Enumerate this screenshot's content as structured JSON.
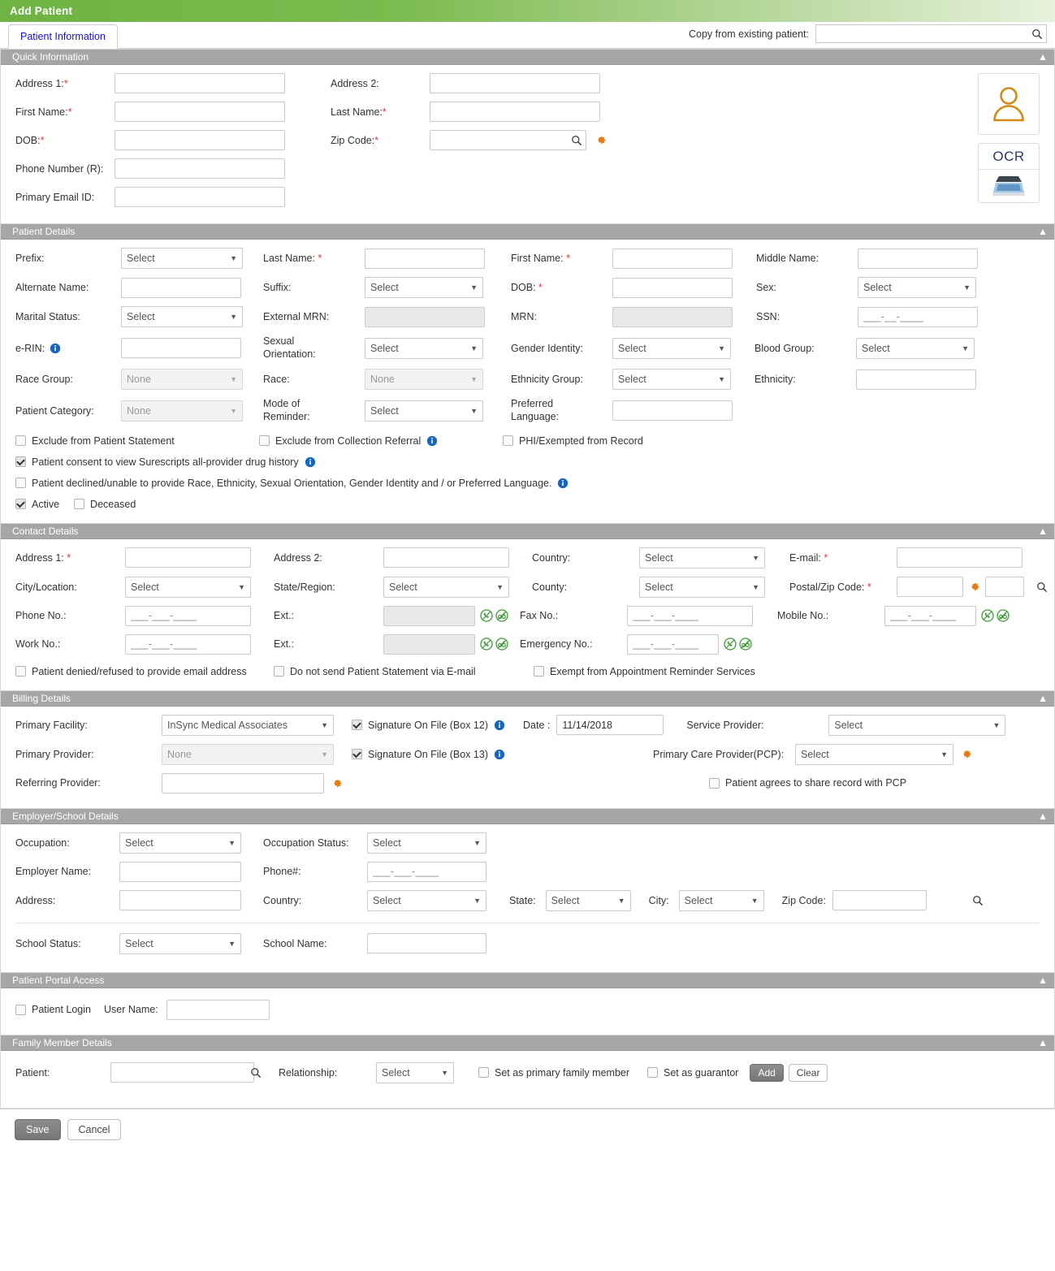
{
  "window": {
    "title": "Add Patient"
  },
  "tabs": [
    {
      "label": "Patient Information"
    }
  ],
  "copy_from": {
    "label": "Copy from existing patient:",
    "value": "",
    "placeholder": ""
  },
  "icons": {
    "search": "search-icon",
    "gear": "gear-icon",
    "info": "info-icon",
    "collapse": "chevron-up-icon",
    "avatar": "patient-avatar-icon",
    "scanner": "scanner-icon",
    "phone_ok": "phone-call-icon",
    "phone_no": "no-call-icon"
  },
  "quick_information": {
    "title": "Quick Information",
    "fields": {
      "address1": {
        "label": "Address 1:",
        "required": true,
        "value": ""
      },
      "address2": {
        "label": "Address 2:",
        "required": false,
        "value": ""
      },
      "first_name": {
        "label": "First Name:",
        "required": true,
        "value": ""
      },
      "last_name": {
        "label": "Last Name:",
        "required": true,
        "value": ""
      },
      "dob": {
        "label": "DOB:",
        "required": true,
        "value": ""
      },
      "zip_code": {
        "label": "Zip Code:",
        "required": true,
        "value": ""
      },
      "phone_r": {
        "label": "Phone Number (R):",
        "required": false,
        "value": ""
      },
      "primary_email": {
        "label": "Primary Email ID:",
        "required": false,
        "value": ""
      }
    },
    "ocr_label": "OCR"
  },
  "patient_details": {
    "title": "Patient Details",
    "fields": {
      "prefix": {
        "label": "Prefix:",
        "value": "Select"
      },
      "last_name": {
        "label": "Last Name:",
        "required": true,
        "value": ""
      },
      "first_name": {
        "label": "First Name:",
        "required": true,
        "value": ""
      },
      "middle_name": {
        "label": "Middle Name:",
        "value": ""
      },
      "alternate_name": {
        "label": "Alternate Name:",
        "value": ""
      },
      "suffix": {
        "label": "Suffix:",
        "value": "Select"
      },
      "dob": {
        "label": "DOB:",
        "required": true,
        "value": ""
      },
      "sex": {
        "label": "Sex:",
        "value": "Select"
      },
      "marital_status": {
        "label": "Marital Status:",
        "value": "Select"
      },
      "external_mrn": {
        "label": "External MRN:",
        "value": ""
      },
      "mrn": {
        "label": "MRN:",
        "value": ""
      },
      "ssn": {
        "label": "SSN:",
        "value": "___-__-____"
      },
      "erin": {
        "label": "e-RIN:",
        "value": ""
      },
      "sexual_orientation": {
        "label": "Sexual Orientation:",
        "value": "Select"
      },
      "gender_identity": {
        "label": "Gender Identity:",
        "value": "Select"
      },
      "blood_group": {
        "label": "Blood Group:",
        "value": "Select"
      },
      "race_group": {
        "label": "Race Group:",
        "value": "None"
      },
      "race": {
        "label": "Race:",
        "value": "None"
      },
      "ethnicity_group": {
        "label": "Ethnicity Group:",
        "value": "Select"
      },
      "ethnicity": {
        "label": "Ethnicity:",
        "value": ""
      },
      "patient_category": {
        "label": "Patient Category:",
        "value": "None"
      },
      "mode_of_reminder": {
        "label": "Mode of Reminder:",
        "value": "Select"
      },
      "preferred_language": {
        "label": "Preferred Language:",
        "value": ""
      }
    },
    "checkboxes": {
      "exclude_statement": {
        "label": "Exclude from Patient Statement",
        "checked": false
      },
      "exclude_collection": {
        "label": "Exclude from Collection Referral",
        "checked": false
      },
      "phi_exempt": {
        "label": "PHI/Exempted from Record",
        "checked": false
      },
      "surescripts_consent": {
        "label": "Patient consent to view Surescripts all-provider drug history",
        "checked": true
      },
      "declined_demographics": {
        "label": "Patient declined/unable to provide Race, Ethnicity, Sexual Orientation, Gender Identity and / or Preferred Language.",
        "checked": false
      },
      "active": {
        "label": "Active",
        "checked": true
      },
      "deceased": {
        "label": "Deceased",
        "checked": false
      }
    }
  },
  "contact_details": {
    "title": "Contact Details",
    "fields": {
      "address1": {
        "label": "Address 1:",
        "required": true,
        "value": ""
      },
      "address2": {
        "label": "Address 2:",
        "value": ""
      },
      "country": {
        "label": "Country:",
        "value": "Select"
      },
      "email": {
        "label": "E-mail:",
        "required": true,
        "value": ""
      },
      "city_location": {
        "label": "City/Location:",
        "value": "Select"
      },
      "state_region": {
        "label": "State/Region:",
        "value": "Select"
      },
      "county": {
        "label": "County:",
        "value": "Select"
      },
      "postal_zip": {
        "label": "Postal/Zip Code:",
        "required": true,
        "value": "",
        "ext_value": ""
      },
      "phone_no": {
        "label": "Phone No.:",
        "value": "___-___-____"
      },
      "phone_ext": {
        "label": "Ext.:",
        "value": ""
      },
      "fax_no": {
        "label": "Fax No.:",
        "value": "___-___-____"
      },
      "mobile_no": {
        "label": "Mobile No.:",
        "value": "___-___-____"
      },
      "work_no": {
        "label": "Work No.:",
        "value": "___-___-____"
      },
      "work_ext": {
        "label": "Ext.:",
        "value": ""
      },
      "emergency_no": {
        "label": "Emergency No.:",
        "value": "___-___-____"
      }
    },
    "checkboxes": {
      "denied_email": {
        "label": "Patient denied/refused to provide email address",
        "checked": false
      },
      "no_statement_email": {
        "label": "Do not send Patient Statement via E-mail",
        "checked": false
      },
      "exempt_reminders": {
        "label": "Exempt from Appointment Reminder Services",
        "checked": false
      }
    }
  },
  "billing_details": {
    "title": "Billing Details",
    "fields": {
      "primary_facility": {
        "label": "Primary Facility:",
        "value": "InSync Medical Associates"
      },
      "primary_provider": {
        "label": "Primary Provider:",
        "value": "None"
      },
      "referring_provider": {
        "label": "Referring Provider:",
        "value": ""
      },
      "date": {
        "label": "Date :",
        "value": "11/14/2018"
      },
      "service_provider": {
        "label": "Service Provider:",
        "value": "Select"
      },
      "pcp": {
        "label": "Primary Care Provider(PCP):",
        "value": "Select"
      }
    },
    "checkboxes": {
      "sig_box12": {
        "label": "Signature On File (Box 12)",
        "checked": true
      },
      "sig_box13": {
        "label": "Signature On File (Box 13)",
        "checked": true
      },
      "share_with_pcp": {
        "label": "Patient agrees to share record with PCP",
        "checked": false
      }
    }
  },
  "employer_school_details": {
    "title": "Employer/School Details",
    "fields": {
      "occupation": {
        "label": "Occupation:",
        "value": "Select"
      },
      "occupation_status": {
        "label": "Occupation Status:",
        "value": "Select"
      },
      "employer_name": {
        "label": "Employer Name:",
        "value": ""
      },
      "phone": {
        "label": "Phone#:",
        "value": "___-___-____"
      },
      "address": {
        "label": "Address:",
        "value": ""
      },
      "country": {
        "label": "Country:",
        "value": "Select"
      },
      "state": {
        "label": "State:",
        "value": "Select"
      },
      "city": {
        "label": "City:",
        "value": "Select"
      },
      "zip_code": {
        "label": "Zip Code:",
        "value": ""
      },
      "school_status": {
        "label": "School Status:",
        "value": "Select"
      },
      "school_name": {
        "label": "School Name:",
        "value": ""
      }
    }
  },
  "patient_portal_access": {
    "title": "Patient Portal Access",
    "patient_login": {
      "label": "Patient Login",
      "checked": false
    },
    "user_name": {
      "label": "User Name:",
      "value": ""
    }
  },
  "family_member_details": {
    "title": "Family Member Details",
    "fields": {
      "patient": {
        "label": "Patient:",
        "value": ""
      },
      "relationship": {
        "label": "Relationship:",
        "value": "Select"
      }
    },
    "checkboxes": {
      "primary_family_member": {
        "label": "Set as primary family member",
        "checked": false
      },
      "guarantor": {
        "label": "Set as guarantor",
        "checked": false
      }
    },
    "buttons": {
      "add": "Add",
      "clear": "Clear"
    }
  },
  "footer": {
    "save": "Save",
    "cancel": "Cancel"
  },
  "colors": {
    "title_bar_green": "#7cbb4f",
    "panel_header_gray": "#a6a6a6",
    "tab_link_blue": "#1414cc",
    "required_red": "#e2383b",
    "gear_orange": "#e8790b",
    "info_blue": "#1566c0",
    "avatar_orange": "#d18a14",
    "phone_green": "#3f9c35"
  }
}
